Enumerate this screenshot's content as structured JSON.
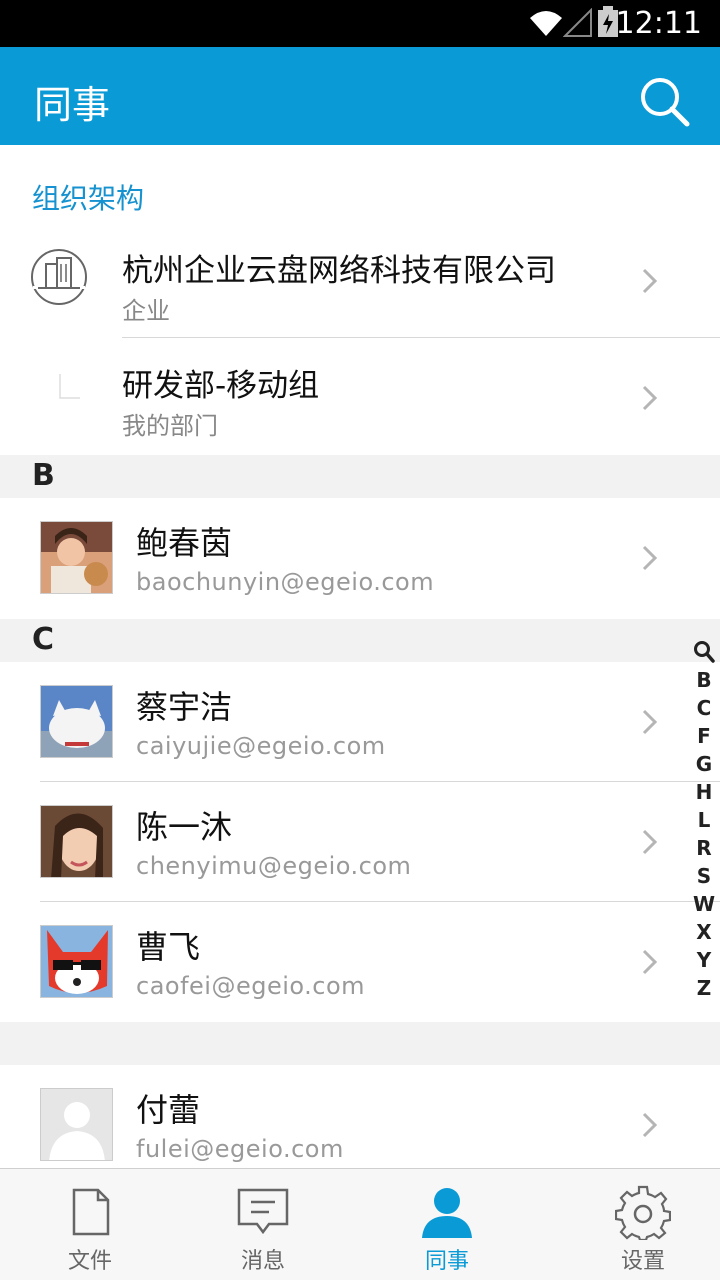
{
  "status_bar": {
    "time": "12:11"
  },
  "app_bar": {
    "title": "同事",
    "search_icon": "search-icon"
  },
  "org_section": {
    "title": "组织架构",
    "items": [
      {
        "name": "杭州企业云盘网络科技有限公司",
        "subtitle": "企业",
        "icon": "building-icon"
      },
      {
        "name": "研发部-移动组",
        "subtitle": "我的部门",
        "icon": "department-icon"
      }
    ]
  },
  "groups": [
    {
      "letter": "B",
      "contacts": [
        {
          "name": "鲍春茵",
          "email": "baochunyin@egeio.com"
        }
      ]
    },
    {
      "letter": "C",
      "contacts": [
        {
          "name": "蔡宇洁",
          "email": "caiyujie@egeio.com"
        },
        {
          "name": "陈一沐",
          "email": "chenyimu@egeio.com"
        },
        {
          "name": "曹飞",
          "email": "caofei@egeio.com"
        }
      ]
    },
    {
      "letter": "",
      "contacts": [
        {
          "name": "付蕾",
          "email": "fulei@egeio.com"
        }
      ]
    }
  ],
  "index_bar": [
    "B",
    "C",
    "F",
    "G",
    "H",
    "L",
    "R",
    "S",
    "W",
    "X",
    "Y",
    "Z"
  ],
  "tabs": [
    {
      "label": "文件",
      "icon": "file-icon"
    },
    {
      "label": "消息",
      "icon": "message-icon"
    },
    {
      "label": "同事",
      "icon": "person-icon",
      "active": true
    },
    {
      "label": "设置",
      "icon": "gear-icon"
    }
  ],
  "colors": {
    "accent": "#0a9ad6",
    "section_title": "#1592cf"
  }
}
